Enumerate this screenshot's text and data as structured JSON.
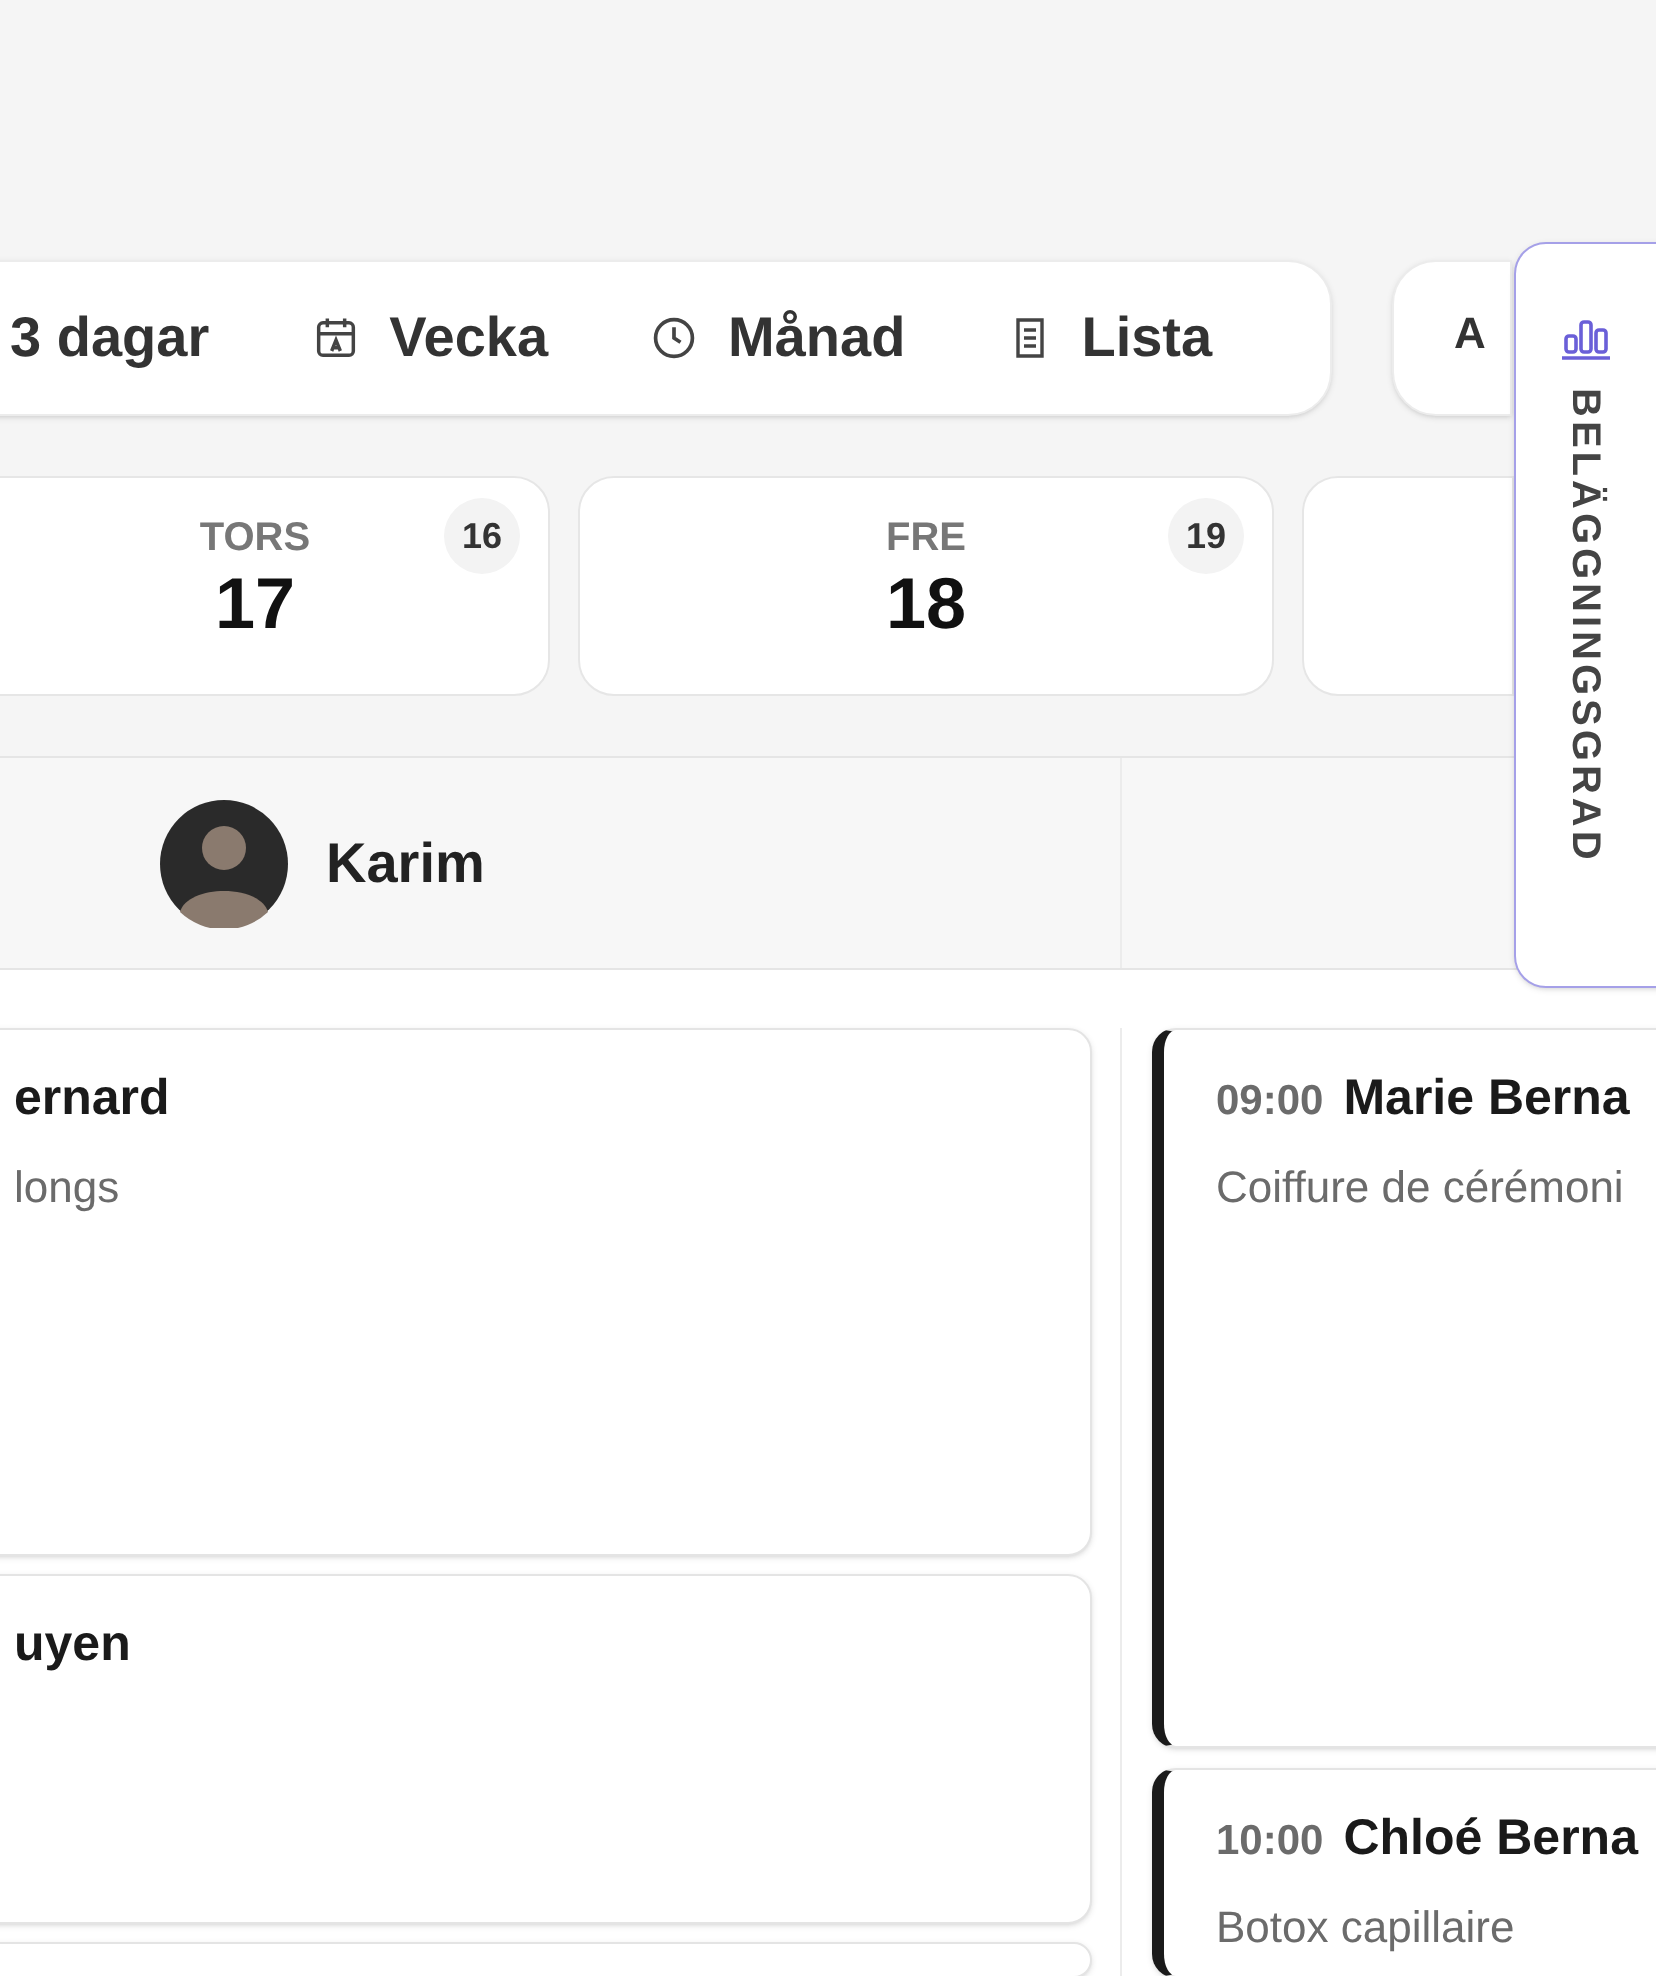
{
  "view_switcher": {
    "items": [
      {
        "label": "3 dagar",
        "kind": "days"
      },
      {
        "label": "Vecka",
        "kind": "week"
      },
      {
        "label": "Månad",
        "kind": "clock"
      },
      {
        "label": "Lista",
        "kind": "list"
      }
    ]
  },
  "secondary_button": {
    "label": "A"
  },
  "occupancy_tab": {
    "label": "BELÄGGNINGSGRAD"
  },
  "days": [
    {
      "weekday": "TORS",
      "date": "17",
      "count": "16"
    },
    {
      "weekday": "FRE",
      "date": "18",
      "count": "19"
    }
  ],
  "staff_header": {
    "name": "Karim"
  },
  "columns": [
    {
      "appointments": [
        {
          "name": "ernard",
          "service": "longs",
          "accent": false,
          "kind": "long"
        },
        {
          "name": "uyen",
          "accent": false,
          "kind": "medium"
        },
        {
          "accent": false,
          "kind": "open"
        }
      ]
    },
    {
      "appointments": [
        {
          "time": "09:00",
          "name": "Marie Berna",
          "service": "Coiffure de cérémoni",
          "accent": true,
          "kind": "tall"
        },
        {
          "time": "10:00",
          "name": "Chloé Berna",
          "service": "Botox capillaire",
          "accent": true,
          "kind": "open"
        }
      ]
    }
  ]
}
